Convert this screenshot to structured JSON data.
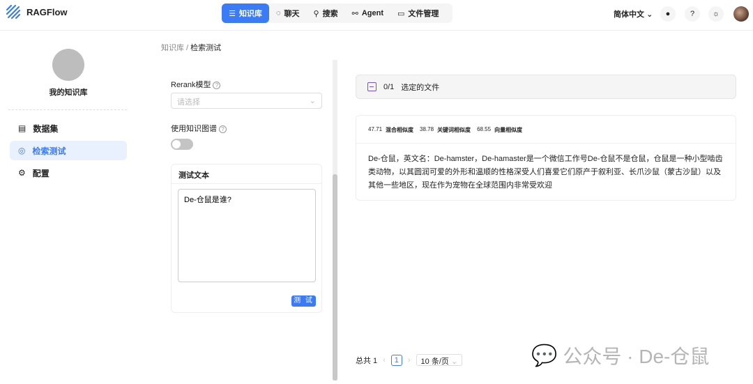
{
  "header": {
    "brand": "RAGFlow",
    "nav": [
      {
        "label": "知识库",
        "icon": "database-icon"
      },
      {
        "label": "聊天",
        "icon": "chat-icon"
      },
      {
        "label": "搜索",
        "icon": "search-icon"
      },
      {
        "label": "Agent",
        "icon": "agent-icon"
      },
      {
        "label": "文件管理",
        "icon": "folder-icon"
      }
    ],
    "language": "简体中文"
  },
  "sidebar": {
    "kb_name": "我的知识库",
    "items": [
      {
        "label": "数据集"
      },
      {
        "label": "检索测试"
      },
      {
        "label": "配置"
      }
    ]
  },
  "breadcrumb": {
    "root": "知识库",
    "current": "检索测试"
  },
  "form": {
    "rerank_label": "Rerank模型",
    "rerank_placeholder": "请选择",
    "kg_label": "使用知识图谱",
    "kg_enabled": false,
    "test_title": "测试文本",
    "test_text": "De-仓鼠是谁?",
    "test_button": "测 试"
  },
  "results": {
    "selected": "0/1",
    "selected_label": "选定的文件",
    "hybrid_score": "47.71",
    "hybrid_label": "混合相似度",
    "keyword_score": "38.78",
    "keyword_label": "关键词相似度",
    "vector_score": "68.55",
    "vector_label": "向量相似度",
    "content": "De-仓鼠，英文名：De-hamster，De-hamaster是一个微信工作号De-仓鼠不是仓鼠，仓鼠是一种小型啮齿类动物，以其圆润可爱的外形和温顺的性格深受人们喜爱它们原产于叙利亚、长爪沙鼠（蒙古沙鼠）以及其他一些地区，现在作为宠物在全球范围内非常受欢迎"
  },
  "pagination": {
    "total": "总共 1",
    "page": "1",
    "page_size": "10 条/页"
  },
  "watermark": "公众号 · De-仓鼠"
}
